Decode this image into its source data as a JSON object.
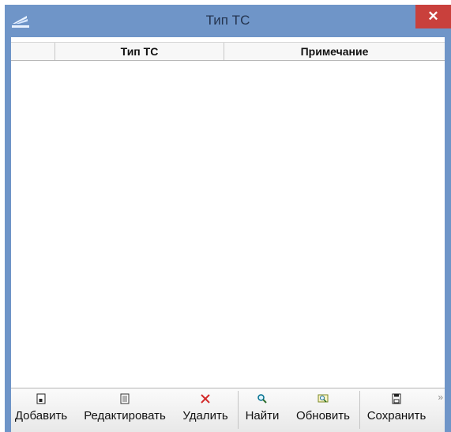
{
  "window": {
    "title": "Тип ТС",
    "close_label": "✕"
  },
  "grid": {
    "columns": [
      "Тип ТС",
      "Примечание"
    ],
    "rows": []
  },
  "toolbar": {
    "buttons": [
      {
        "label": "Добавить",
        "icon": "add-document-icon"
      },
      {
        "label": "Редактировать",
        "icon": "edit-document-icon"
      },
      {
        "label": "Удалить",
        "icon": "delete-x-icon"
      },
      {
        "label": "Найти",
        "icon": "search-icon"
      },
      {
        "label": "Обновить",
        "icon": "refresh-search-icon"
      },
      {
        "label": "Сохранить",
        "icon": "save-disk-icon"
      }
    ],
    "overflow_label": "»"
  },
  "colors": {
    "titlebar": "#6f95c8",
    "close_button": "#c9403c",
    "delete_icon": "#d22a2a"
  }
}
